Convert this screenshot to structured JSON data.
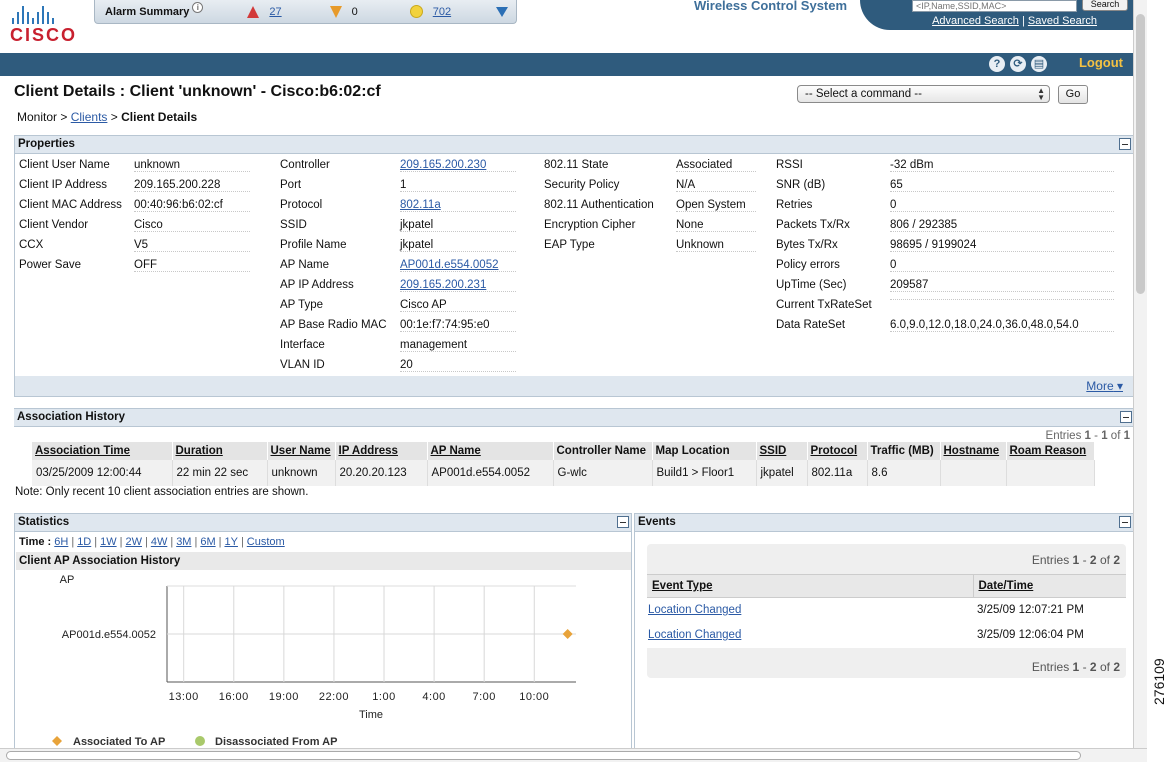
{
  "header": {
    "logo_text": "CISCO",
    "alarm_summary_label": "Alarm Summary",
    "alarm_critical": "27",
    "alarm_major": "0",
    "alarm_minor": "702",
    "app_title": "Wireless Control System",
    "search_placeholder": "<IP,Name,SSID,MAC>",
    "search_button": "Search",
    "advanced_search": "Advanced Search",
    "saved_search": "Saved Search",
    "logout": "Logout",
    "colors": {
      "nav_bar": "#2f5b7d",
      "logout": "#f5c242",
      "critical": "#d23a3a",
      "major": "#e79a2a",
      "minor": "#f2d23c"
    }
  },
  "page": {
    "title": "Client Details : Client 'unknown' - Cisco:b6:02:cf",
    "breadcrumb": {
      "monitor": "Monitor",
      "sep": ">",
      "clients": "Clients",
      "current": "Client Details"
    },
    "command_select": "-- Select a command --",
    "go_button": "Go"
  },
  "properties": {
    "title": "Properties",
    "col1": [
      {
        "label": "Client User Name",
        "value": "unknown"
      },
      {
        "label": "Client IP Address",
        "value": "209.165.200.228"
      },
      {
        "label": "Client MAC Address",
        "value": "00:40:96:b6:02:cf"
      },
      {
        "label": "Client Vendor",
        "value": "Cisco"
      },
      {
        "label": "CCX",
        "value": "V5"
      },
      {
        "label": "Power Save",
        "value": "OFF"
      }
    ],
    "col2": [
      {
        "label": "Controller",
        "value": "209.165.200.230",
        "link": true
      },
      {
        "label": "Port",
        "value": "1"
      },
      {
        "label": "Protocol",
        "value": "802.11a",
        "link": true
      },
      {
        "label": "SSID",
        "value": "jkpatel"
      },
      {
        "label": "Profile Name",
        "value": "jkpatel"
      },
      {
        "label": "AP Name",
        "value": "AP001d.e554.0052",
        "link": true
      },
      {
        "label": "AP IP Address",
        "value": "209.165.200.231",
        "link": true
      },
      {
        "label": "AP Type",
        "value": "Cisco AP"
      },
      {
        "label": "AP Base Radio MAC",
        "value": "00:1e:f7:74:95:e0"
      },
      {
        "label": "Interface",
        "value": "management"
      },
      {
        "label": "VLAN ID",
        "value": "20"
      }
    ],
    "col3": [
      {
        "label": "802.11 State",
        "value": "Associated"
      },
      {
        "label": "Security Policy",
        "value": "N/A"
      },
      {
        "label": "802.11 Authentication",
        "value": "Open System"
      },
      {
        "label": "Encryption Cipher",
        "value": "None"
      },
      {
        "label": "EAP Type",
        "value": "Unknown"
      }
    ],
    "col4": [
      {
        "label": "RSSI",
        "value": "-32 dBm"
      },
      {
        "label": "SNR (dB)",
        "value": "65"
      },
      {
        "label": "Retries",
        "value": "0"
      },
      {
        "label": "Packets Tx/Rx",
        "value": "806 / 292385"
      },
      {
        "label": "Bytes Tx/Rx",
        "value": "98695 / 9199024"
      },
      {
        "label": "Policy errors",
        "value": "0"
      },
      {
        "label": "UpTime (Sec)",
        "value": "209587"
      },
      {
        "label": "Current TxRateSet",
        "value": ""
      },
      {
        "label": "Data RateSet",
        "value": "6.0,9.0,12.0,18.0,24.0,36.0,48.0,54.0"
      }
    ],
    "more": "More"
  },
  "association_history": {
    "title": "Association History",
    "entries_label": "Entries",
    "entries_from": "1",
    "entries_sep": "-",
    "entries_to": "1",
    "entries_of": "of",
    "entries_total": "1",
    "columns": [
      "Association Time",
      "Duration",
      "User Name",
      "IP Address",
      "AP Name",
      "Controller Name",
      "Map Location",
      "SSID",
      "Protocol",
      "Traffic (MB)",
      "Hostname",
      "Roam Reason"
    ],
    "rows": [
      [
        "03/25/2009 12:00:44",
        "22 min 22 sec",
        "unknown",
        "20.20.20.123",
        "AP001d.e554.0052",
        "G-wlc",
        "Build1 > Floor1",
        "jkpatel",
        "802.11a",
        "8.6",
        "",
        ""
      ]
    ],
    "note": "Note: Only recent 10 client association entries are shown."
  },
  "statistics": {
    "title": "Statistics",
    "time_label": "Time :",
    "ranges": [
      "6H",
      "1D",
      "1W",
      "2W",
      "4W",
      "3M",
      "6M",
      "1Y",
      "Custom"
    ],
    "chart_title": "Client AP Association History",
    "legend_associated": "Associated To AP",
    "legend_disassociated": "Disassociated From AP"
  },
  "chart_data": {
    "type": "scatter",
    "title": "Client AP Association History",
    "xlabel": "Time",
    "ylabel": "AP",
    "x_ticks": [
      "13:00",
      "16:00",
      "19:00",
      "22:00",
      "1:00",
      "4:00",
      "7:00",
      "10:00"
    ],
    "y_categories": [
      "AP001d.e554.0052"
    ],
    "grid": true,
    "series": [
      {
        "name": "Associated To AP",
        "color": "#e8a33a",
        "marker": "diamond",
        "points": [
          {
            "x": "12:00",
            "y": "AP001d.e554.0052"
          }
        ]
      },
      {
        "name": "Disassociated From AP",
        "color": "#a9c96b",
        "marker": "circle",
        "points": []
      }
    ]
  },
  "events": {
    "title": "Events",
    "entries_label": "Entries",
    "entries_from": "1",
    "entries_sep": "-",
    "entries_to": "2",
    "entries_of": "of",
    "entries_total": "2",
    "columns": [
      "Event Type",
      "Date/Time"
    ],
    "rows": [
      {
        "type": "Location Changed",
        "time": "3/25/09 12:07:21 PM"
      },
      {
        "type": "Location Changed",
        "time": "3/25/09 12:06:04 PM"
      }
    ]
  },
  "side_label": "276109"
}
